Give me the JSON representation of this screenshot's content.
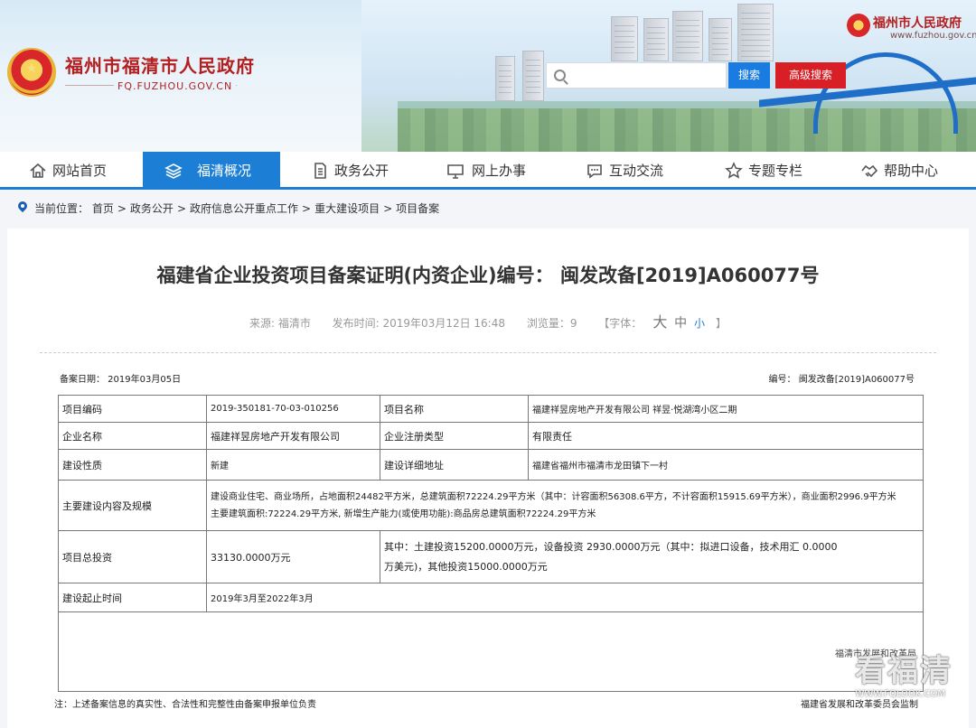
{
  "header": {
    "site_title": "福州市福清市人民政府",
    "site_domain": "FQ.FUZHOU.GOV.CN",
    "gov_title": "福州市人民政府",
    "gov_domain": "www.fuzhou.gov.cn",
    "search": {
      "placeholder": "",
      "value": "",
      "button": "搜索",
      "advanced_button": "高级搜索"
    }
  },
  "nav": {
    "items": [
      {
        "label": "网站首页",
        "icon": "home-icon"
      },
      {
        "label": "福清概况",
        "icon": "layers-icon",
        "active": true
      },
      {
        "label": "政务公开",
        "icon": "document-icon"
      },
      {
        "label": "网上办事",
        "icon": "monitor-icon"
      },
      {
        "label": "互动交流",
        "icon": "chat-icon"
      },
      {
        "label": "专题专栏",
        "icon": "star-icon"
      },
      {
        "label": "帮助中心",
        "icon": "handshake-icon"
      }
    ]
  },
  "breadcrumb": {
    "prefix": "当前位置：",
    "items": [
      "首页",
      "政务公开",
      "政府信息公开重点工作",
      "重大建设项目",
      "项目备案"
    ]
  },
  "article": {
    "title": "福建省企业投资项目备案证明(内资企业)编号： 闽发改备[2019]A060077号",
    "source": "来源: 福清市",
    "published": "发布时间: 2019年03月12日 16:48",
    "views": "浏览量：9",
    "font_label": "【字体：",
    "font_big": "大",
    "font_mid": "中",
    "font_small": "小",
    "font_end": "】"
  },
  "certificate": {
    "record_date": "备案日期： 2019年03月05日",
    "number": "编号： 闽发改备[2019]A060077号",
    "rows": {
      "project_code_label": "项目编码",
      "project_code": "2019-350181-70-03-010256",
      "project_name_label": "项目名称",
      "project_name": "福建祥昱房地产开发有限公司 祥昱·悦湖湾小区二期",
      "company_label": "企业名称",
      "company": "福建祥昱房地产开发有限公司",
      "reg_type_label": "企业注册类型",
      "reg_type": "有限责任",
      "nature_label": "建设性质",
      "nature": "新建",
      "address_label": "建设详细地址",
      "address": "福建省福州市福清市龙田镇下一村",
      "content_label": "主要建设内容及规模",
      "content_1": "建设商业住宅、商业场所，占地面积24482平方米，总建筑面积72224.29平方米（其中：计容面积56308.6平方，不计容面积15915.69平方米），商业面积2996.9平方米",
      "content_2": "主要建筑面积:72224.29平方米, 新增生产能力(或使用功能):商品房总建筑面积72224.29平方米",
      "investment_label": "项目总投资",
      "investment": "33130.0000万元",
      "investment_detail_1": "其中：土建投资15200.0000万元，设备投资 2930.0000万元（其中：拟进口设备，技术用汇 0.0000",
      "investment_detail_2": "万美元)，其他投资15000.0000万元",
      "period_label": "建设起止时间",
      "period": "2019年3月至2022年3月"
    },
    "org_stamp": "福清市发展和改革局",
    "footer_note": "注：上述备案信息的真实性、合法性和完整性由备案申报单位负责",
    "footer_org": "福建省发展和改革委员会监制"
  },
  "watermark": {
    "text": "看福清",
    "url": "WWW.FQLOOK.COM"
  },
  "colors": {
    "nav_active": "#1c7fd5",
    "search_btn": "#1a7ce0",
    "adv_btn": "#d91f26",
    "title_red": "#b41f1f"
  }
}
